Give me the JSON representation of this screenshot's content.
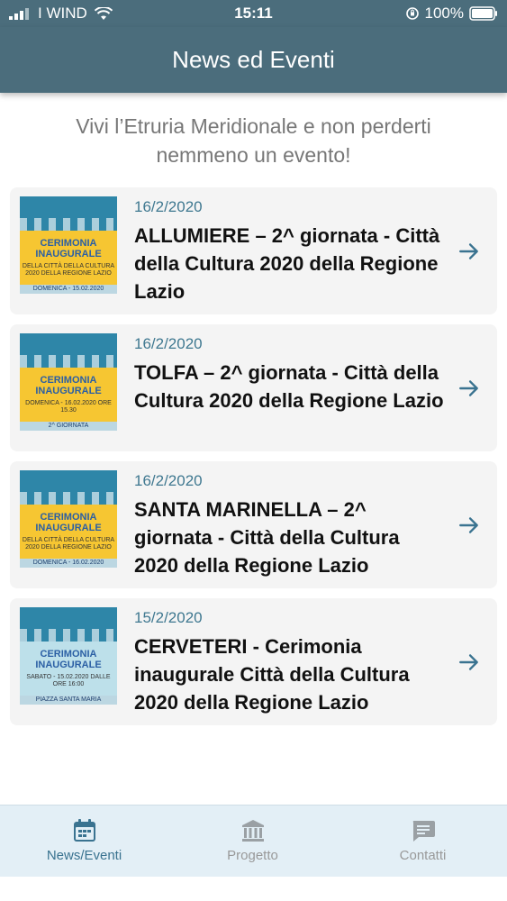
{
  "status_bar": {
    "carrier": "I WIND",
    "time": "15:11",
    "battery": "100%"
  },
  "header": {
    "title": "News ed Eventi"
  },
  "intro": "Vivi l’Etruria Meridionale e non perderti nemmeno un evento!",
  "news": [
    {
      "date": "16/2/2020",
      "title": "ALLUMIERE – 2^ giornata - Città della Cultura 2020 della Regione Lazio",
      "thumb": {
        "head": "CERIMONIA INAUGURALE",
        "sub": "DELLA CITTÀ DELLA CULTURA 2020 DELLA REGIONE LAZIO",
        "foot": "DOMENICA - 15.02.2020"
      }
    },
    {
      "date": "16/2/2020",
      "title": "TOLFA – 2^ giornata - Città della Cultura 2020 della Regione Lazio",
      "thumb": {
        "head": "CERIMONIA INAUGURALE",
        "sub": "DOMENICA - 16.02.2020 ORE 15.30",
        "foot": "2^ GIORNATA"
      }
    },
    {
      "date": "16/2/2020",
      "title": "SANTA MARINELLA – 2^ giornata - Città della Cultura 2020 della Regione Lazio",
      "thumb": {
        "head": "CERIMONIA INAUGURALE",
        "sub": "DELLA CITTÀ DELLA CULTURA 2020 DELLA REGIONE LAZIO",
        "foot": "DOMENICA - 16.02.2020"
      }
    },
    {
      "date": "15/2/2020",
      "title": "CERVETERI - Cerimonia inaugurale Città della Cultura 2020 della Regione Lazio",
      "thumb": {
        "head": "CERIMONIA INAUGURALE",
        "sub": "SABATO - 15.02.2020 DALLE ORE 16:00",
        "foot": "PIAZZA SANTA MARIA"
      }
    }
  ],
  "tabs": [
    {
      "label": "News/Eventi",
      "icon": "calendar-icon",
      "active": true
    },
    {
      "label": "Progetto",
      "icon": "museum-icon",
      "active": false
    },
    {
      "label": "Contatti",
      "icon": "chat-icon",
      "active": false
    }
  ],
  "colors": {
    "header_bg": "#4b6d7c",
    "accent": "#3a7390",
    "card_bg": "#f4f4f4",
    "tabbar_bg": "#e3eff6"
  }
}
